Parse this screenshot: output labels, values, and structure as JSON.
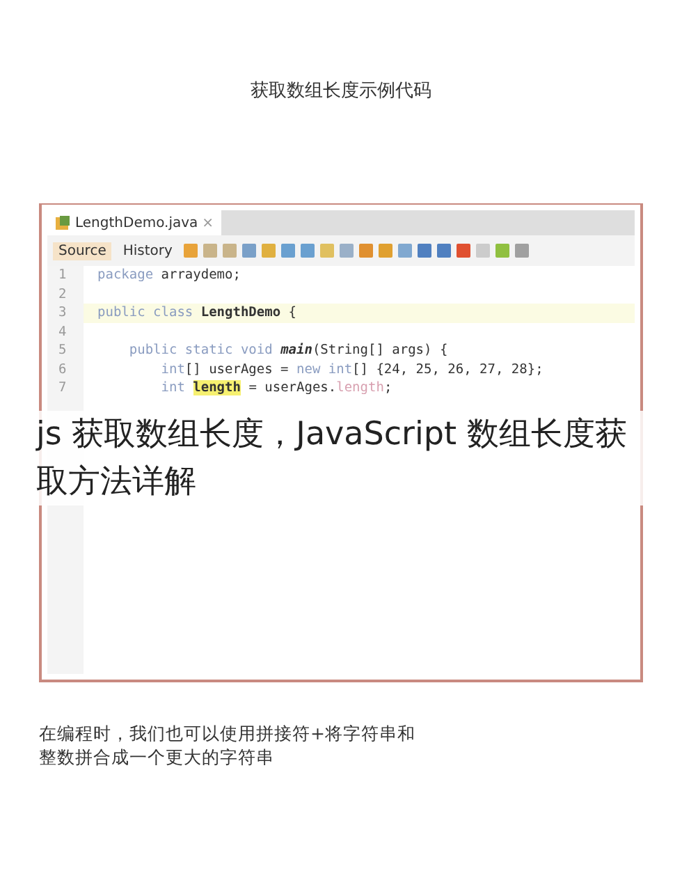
{
  "heading": "获取数组长度示例代码",
  "editor": {
    "tab": {
      "label": "LengthDemo.java",
      "close": "×"
    },
    "views": [
      {
        "label": "Source",
        "selected": true
      },
      {
        "label": "History",
        "selected": false
      }
    ],
    "lines": [
      {
        "number": "1",
        "highlighted": false,
        "tokens": [
          {
            "text": "package ",
            "kind": "kw"
          },
          {
            "text": "arraydemo;",
            "kind": "plain"
          }
        ]
      },
      {
        "number": "2",
        "highlighted": false
      },
      {
        "number": "3",
        "highlighted": true,
        "tokens": [
          {
            "text": "public class ",
            "kind": "kw"
          },
          {
            "text": "LengthDemo",
            "kind": "bold"
          },
          {
            "text": " {",
            "kind": "plain"
          }
        ]
      },
      {
        "number": "4",
        "highlighted": false
      },
      {
        "number": "5",
        "highlighted": false,
        "tokens": [
          {
            "text": "    public static void ",
            "kind": "kw"
          },
          {
            "text": "main",
            "kind": "bolditalic"
          },
          {
            "text": "(String[] args) {",
            "kind": "plain"
          }
        ]
      },
      {
        "number": "6",
        "highlighted": false,
        "tokens": [
          {
            "text": "        int",
            "kind": "kw"
          },
          {
            "text": "[] userAges = ",
            "kind": "plain"
          },
          {
            "text": "new int",
            "kind": "kw"
          },
          {
            "text": "[] {24, 25, 26, 27, 28};",
            "kind": "plain"
          }
        ]
      },
      {
        "number": "7",
        "highlighted": false,
        "tokens": [
          {
            "text": "        int ",
            "kind": "kw"
          },
          {
            "text": "length",
            "kind": "mark"
          },
          {
            "text": " = userAges.",
            "kind": "plain"
          },
          {
            "text": "length",
            "kind": "field"
          },
          {
            "text": ";",
            "kind": "plain"
          }
        ]
      }
    ]
  },
  "overlay_title": "js 获取数组长度，JavaScript 数组长度获取方法详解",
  "caption": "在编程时，我们也可以使用拼接符+将字符串和整数拼合成一个更大的字符串"
}
